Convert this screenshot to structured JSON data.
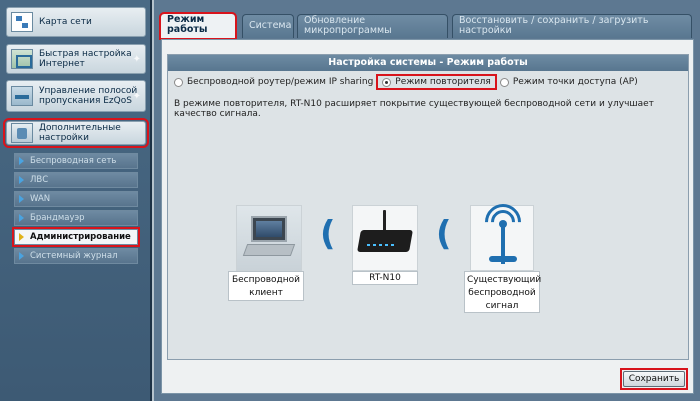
{
  "sidebar": {
    "top_items": [
      {
        "label": "Карта сети",
        "icon": "network-map-icon"
      },
      {
        "label": "Быстрая настройка Интернет",
        "icon": "quick-setup-icon"
      },
      {
        "label": "Управление полосой пропускания EzQoS",
        "icon": "qos-icon"
      },
      {
        "label": "Дополнительные настройки",
        "icon": "advanced-settings-icon"
      }
    ],
    "sub_items": [
      {
        "label": "Беспроводная сеть"
      },
      {
        "label": "ЛВС"
      },
      {
        "label": "WAN"
      },
      {
        "label": "Брандмауэр"
      },
      {
        "label": "Администрирование"
      },
      {
        "label": "Системный журнал"
      }
    ]
  },
  "tabs": [
    {
      "label": "Режим работы"
    },
    {
      "label": "Система"
    },
    {
      "label": "Обновление микропрограммы"
    },
    {
      "label": "Восстановить / сохранить / загрузить настройки"
    }
  ],
  "panel": {
    "title": "Настройка системы - Режим работы",
    "modes": [
      {
        "label": "Беспроводной роутер/режим IP sharing",
        "selected": false
      },
      {
        "label": "Режим повторителя",
        "selected": true
      },
      {
        "label": "Режим точки доступа (AP)",
        "selected": false
      }
    ],
    "description": "В режиме повторителя, RT-N10 расширяет покрытие существующей беспроводной сети и улучшает качество сигнала.",
    "diagram": {
      "client_label": "Беспроводной клиент",
      "router_label": "RT-N10",
      "signal_label": "Существующий беспроводной сигнал"
    },
    "save_label": "Сохранить"
  },
  "colors": {
    "highlight": "#d8141c",
    "accent_blue": "#1f6fb0"
  }
}
